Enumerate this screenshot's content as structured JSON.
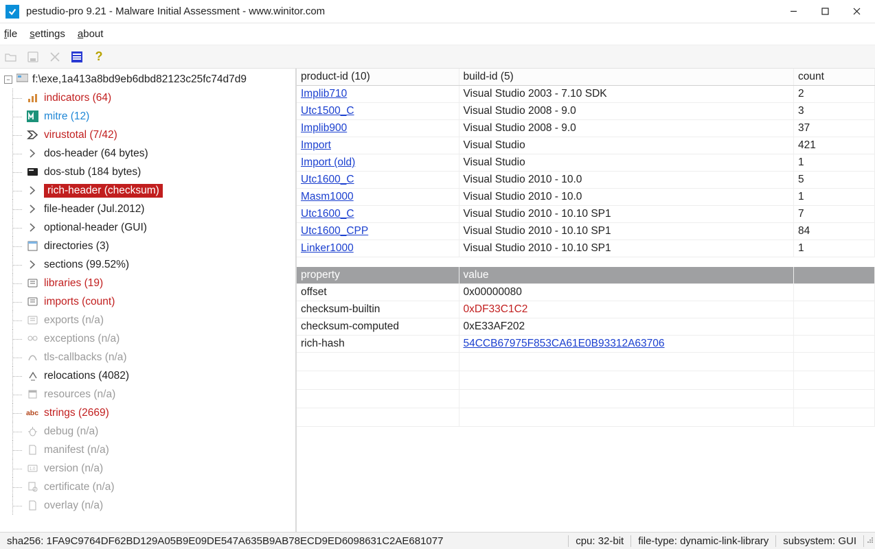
{
  "title": "pestudio-pro 9.21 - Malware Initial Assessment - www.winitor.com",
  "menu": {
    "file": "file",
    "settings": "settings",
    "about": "about"
  },
  "tree": {
    "root": "f:\\exe,1a413a8bd9eb6dbd82123c25fc74d7d9",
    "items": [
      {
        "name": "indicators",
        "label": "indicators (64)",
        "class": "red",
        "icon": "bars"
      },
      {
        "name": "mitre",
        "label": "mitre (12)",
        "class": "blue",
        "icon": "mitre"
      },
      {
        "name": "virustotal",
        "label": "virustotal (7/42)",
        "class": "red",
        "icon": "vt"
      },
      {
        "name": "dos-header",
        "label": "dos-header (64 bytes)",
        "class": "",
        "icon": "chevron"
      },
      {
        "name": "dos-stub",
        "label": "dos-stub (184 bytes)",
        "class": "",
        "icon": "stub"
      },
      {
        "name": "rich-header",
        "label": "rich-header (checksum)",
        "class": "selected",
        "icon": "chevron"
      },
      {
        "name": "file-header",
        "label": "file-header (Jul.2012)",
        "class": "",
        "icon": "chevron"
      },
      {
        "name": "optional-header",
        "label": "optional-header (GUI)",
        "class": "",
        "icon": "chevron"
      },
      {
        "name": "directories",
        "label": "directories (3)",
        "class": "",
        "icon": "dir"
      },
      {
        "name": "sections",
        "label": "sections (99.52%)",
        "class": "",
        "icon": "chevron"
      },
      {
        "name": "libraries",
        "label": "libraries (19)",
        "class": "red",
        "icon": "lib"
      },
      {
        "name": "imports",
        "label": "imports (count)",
        "class": "red",
        "icon": "lib"
      },
      {
        "name": "exports",
        "label": "exports (n/a)",
        "class": "gray",
        "icon": "lib"
      },
      {
        "name": "exceptions",
        "label": "exceptions (n/a)",
        "class": "gray",
        "icon": "exc"
      },
      {
        "name": "tls-callbacks",
        "label": "tls-callbacks (n/a)",
        "class": "gray",
        "icon": "tls"
      },
      {
        "name": "relocations",
        "label": "relocations (4082)",
        "class": "",
        "icon": "reloc"
      },
      {
        "name": "resources",
        "label": "resources (n/a)",
        "class": "gray",
        "icon": "res"
      },
      {
        "name": "strings",
        "label": "strings (2669)",
        "class": "red",
        "icon": "abc"
      },
      {
        "name": "debug",
        "label": "debug (n/a)",
        "class": "gray",
        "icon": "bug"
      },
      {
        "name": "manifest",
        "label": "manifest (n/a)",
        "class": "gray",
        "icon": "doc"
      },
      {
        "name": "version",
        "label": "version (n/a)",
        "class": "gray",
        "icon": "ver"
      },
      {
        "name": "certificate",
        "label": "certificate (n/a)",
        "class": "gray",
        "icon": "cert"
      },
      {
        "name": "overlay",
        "label": "overlay (n/a)",
        "class": "gray",
        "icon": "doc"
      }
    ]
  },
  "rich": {
    "headers": {
      "product": "product-id  (10)",
      "build": "build-id  (5)",
      "count": "count"
    },
    "rows": [
      {
        "product": "Implib710",
        "build": "Visual Studio 2003 - 7.10 SDK",
        "count": "2"
      },
      {
        "product": "Utc1500_C",
        "build": "Visual Studio 2008 - 9.0",
        "count": "3"
      },
      {
        "product": "Implib900",
        "build": "Visual Studio 2008 - 9.0",
        "count": "37"
      },
      {
        "product": "Import",
        "build": "Visual Studio",
        "count": "421"
      },
      {
        "product": "Import (old)",
        "build": "Visual Studio",
        "count": "1"
      },
      {
        "product": "Utc1600_C",
        "build": "Visual Studio 2010 - 10.0",
        "count": "5"
      },
      {
        "product": "Masm1000",
        "build": "Visual Studio 2010 - 10.0",
        "count": "1"
      },
      {
        "product": "Utc1600_C",
        "build": "Visual Studio 2010 - 10.10 SP1",
        "count": "7"
      },
      {
        "product": "Utc1600_CPP",
        "build": "Visual Studio 2010 - 10.10 SP1",
        "count": "84"
      },
      {
        "product": "Linker1000",
        "build": "Visual Studio 2010 - 10.10 SP1",
        "count": "1"
      }
    ],
    "propHeaders": {
      "prop": "property",
      "val": "value"
    },
    "props": [
      {
        "k": "offset",
        "v": "0x00000080",
        "cls": ""
      },
      {
        "k": "checksum-builtin",
        "v": "0xDF33C1C2",
        "cls": "red-text"
      },
      {
        "k": "checksum-computed",
        "v": "0xE33AF202",
        "cls": ""
      },
      {
        "k": "rich-hash",
        "v": "54CCB67975F853CA61E0B93312A63706",
        "cls": "link"
      }
    ]
  },
  "status": {
    "sha": "sha256: 1FA9C9764DF62BD129A05B9E09DE547A635B9AB78ECD9ED6098631C2AE681077",
    "cpu": "cpu: 32-bit",
    "ftype": "file-type: dynamic-link-library",
    "subsys": "subsystem: GUI"
  }
}
